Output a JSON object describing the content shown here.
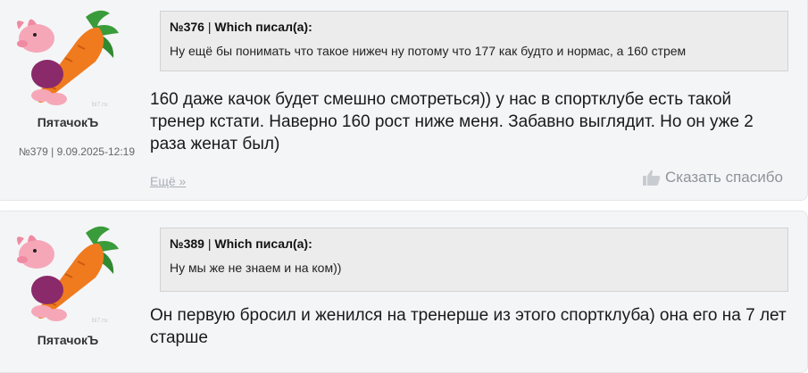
{
  "posts": [
    {
      "author": "ПятачокЪ",
      "meta": "№379 | 9.09.2025-12:19",
      "quote": {
        "number": "№376",
        "separator": " | ",
        "who": "Which писал(а):",
        "text": "Ну ещё бы понимать что такое нижеч ну потому что 177 как будто и нормас, а 160 стрем"
      },
      "text": "160 даже качок будет смешно смотреться)) у нас в спортклубе есть такой тренер кстати. Наверно 160 рост ниже меня. Забавно выглядит. Но он уже 2 раза женат был)",
      "more": "Ещё »",
      "thanks": "Сказать спасибо"
    },
    {
      "author": "ПятачокЪ",
      "quote": {
        "number": "№389",
        "separator": " | ",
        "who": "Which писал(а):",
        "text": "Ну мы же не знаем и на ком))"
      },
      "text": "Он первую бросил и женился на тренерше из этого спортклуба) она его на 7 лет старше"
    }
  ],
  "icons": {
    "avatar": "piglet-with-carrot-avatar",
    "thanks": "thumbs-up-icon"
  },
  "colors": {
    "carrot": "#f07a1e",
    "leaves": "#3a9b3a",
    "piglet": "#f5a7b8"
  }
}
